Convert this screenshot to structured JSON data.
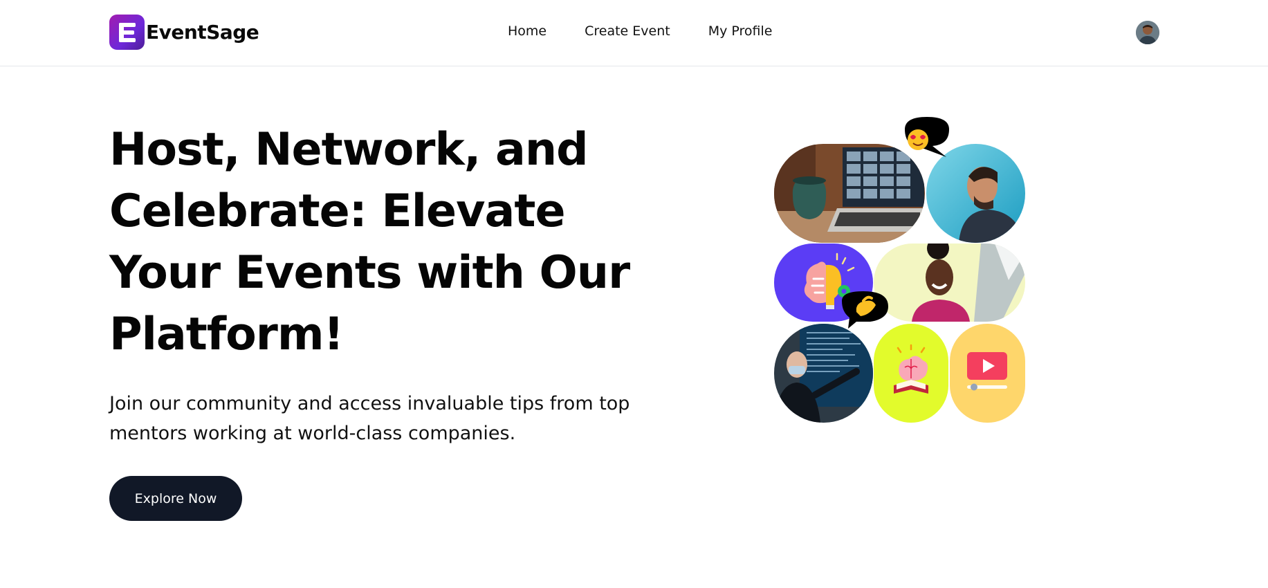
{
  "header": {
    "brand_name": "EventSage",
    "nav": [
      {
        "label": "Home"
      },
      {
        "label": "Create Event"
      },
      {
        "label": "My Profile"
      }
    ]
  },
  "hero": {
    "title": "Host, Network, and Celebrate: Elevate Your Events with Our Platform!",
    "subtitle": "Join our community and access invaluable tips from top mentors working at world-class companies.",
    "cta_label": "Explore Now"
  },
  "colors": {
    "brand_gradient_start": "#a21caf",
    "brand_gradient_end": "#6d28d9",
    "cta_background": "#111827",
    "collage_purple": "#5b3df5",
    "collage_lime": "#e2fb2c",
    "collage_yellow": "#fed66b"
  }
}
